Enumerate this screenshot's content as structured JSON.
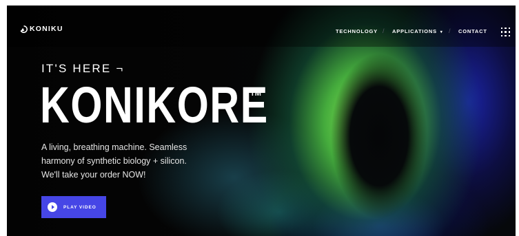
{
  "header": {
    "logo_text": "KONIKU",
    "nav": [
      {
        "label": "TECHNOLOGY"
      },
      {
        "label": "APPLICATIONS"
      },
      {
        "label": "CONTACT"
      }
    ],
    "nav_separator": "/",
    "applications_caret": "▾",
    "menu_icon": "grid-dots-icon"
  },
  "hero": {
    "eyebrow": "IT'S HERE ¬",
    "headline": "KONIKORE",
    "trademark": "TM",
    "tagline_lines": [
      "A living, breathing machine. Seamless",
      "harmony of synthetic biology + silicon.",
      "We'll take your order NOW!"
    ],
    "play_button_label": "PLAY VIDEO",
    "play_icon": "play-icon"
  },
  "colors": {
    "accent": "#4646e6",
    "text": "#ffffff",
    "background": "#050505"
  }
}
